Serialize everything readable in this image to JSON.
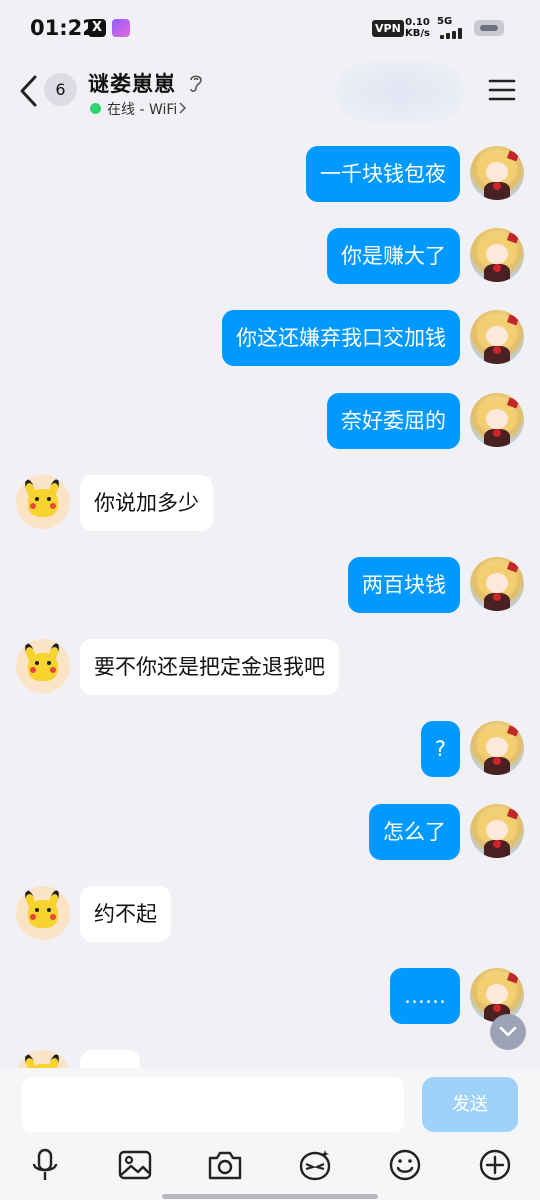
{
  "status_bar": {
    "time": "01:22",
    "x_app_icon": "X",
    "vpn": "VPN",
    "speed_value": "0.10",
    "speed_unit": "KB/s",
    "network": "5G"
  },
  "header": {
    "unread_count": "6",
    "contact_name": "谜娄崽崽",
    "online_status": "在线 - WiFi"
  },
  "messages": [
    {
      "side": "me",
      "text": "一千块钱包夜"
    },
    {
      "side": "me",
      "text": "你是赚大了"
    },
    {
      "side": "me",
      "text": "你这还嫌弃我口交加钱"
    },
    {
      "side": "me",
      "text": "奈好委屈的"
    },
    {
      "side": "peer",
      "text": "你说加多少"
    },
    {
      "side": "me",
      "text": "两百块钱"
    },
    {
      "side": "peer",
      "text": "要不你还是把定金退我吧"
    },
    {
      "side": "me",
      "text": "?"
    },
    {
      "side": "me",
      "text": "怎么了"
    },
    {
      "side": "peer",
      "text": "约不起"
    },
    {
      "side": "me",
      "text": "……"
    },
    {
      "side": "peer",
      "text": ""
    }
  ],
  "composer": {
    "input_value": "",
    "send_label": "发送"
  },
  "toolbar_icons": [
    "microphone-icon",
    "image-icon",
    "camera-icon",
    "sticker-icon",
    "emoji-icon",
    "plus-icon"
  ],
  "colors": {
    "outgoing_bubble": "#0099ff",
    "incoming_bubble": "#ffffff",
    "background": "#f1f1f5",
    "send_button_disabled": "#9fd2f8",
    "online_dot": "#2dd36f"
  }
}
